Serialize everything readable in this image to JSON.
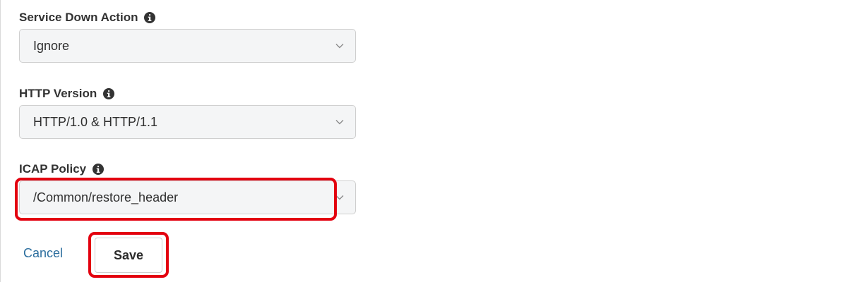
{
  "form": {
    "service_down_action": {
      "label": "Service Down Action",
      "value": "Ignore",
      "icon": "info-circle-icon"
    },
    "http_version": {
      "label": "HTTP Version",
      "value": "HTTP/1.0 & HTTP/1.1",
      "icon": "info-circle-icon"
    },
    "icap_policy": {
      "label": "ICAP Policy",
      "value": "/Common/restore_header",
      "icon": "info-circle-icon"
    }
  },
  "actions": {
    "cancel_label": "Cancel",
    "save_label": "Save"
  },
  "colors": {
    "highlight": "#e3000f",
    "link": "#2c6e9e",
    "select_bg": "#f4f5f6"
  }
}
